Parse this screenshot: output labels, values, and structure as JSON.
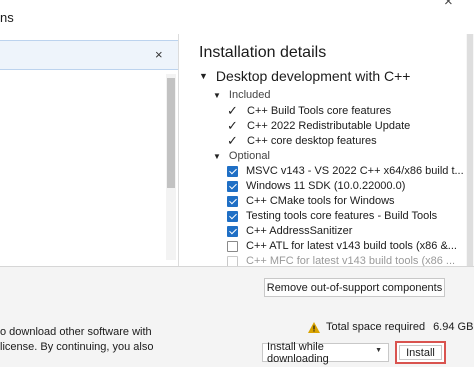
{
  "window": {
    "title": "ns",
    "close_icon": "close-icon"
  },
  "left_pane": {
    "search_value": "",
    "clear_icon": "×"
  },
  "details": {
    "title": "Installation details",
    "workload": "Desktop development with C++",
    "included_label": "Included",
    "included_items": [
      {
        "label": "C++ Build Tools core features"
      },
      {
        "label": "C++ 2022 Redistributable Update"
      },
      {
        "label": "C++ core desktop features"
      }
    ],
    "optional_label": "Optional",
    "optional_items": [
      {
        "label": "MSVC v143 - VS 2022 C++ x64/x86 build t...",
        "checked": true
      },
      {
        "label": "Windows 11 SDK (10.0.22000.0)",
        "checked": true
      },
      {
        "label": "C++ CMake tools for Windows",
        "checked": true
      },
      {
        "label": "Testing tools core features - Build Tools",
        "checked": true
      },
      {
        "label": "C++ AddressSanitizer",
        "checked": true
      },
      {
        "label": "C++ ATL for latest v143 build tools (x86 &...",
        "checked": false
      },
      {
        "label": "C++ MFC for latest v143 build tools (x86 ...",
        "checked": false
      }
    ]
  },
  "bottom": {
    "remove_label": "Remove out-of-support components",
    "license_line1": "o download other software with",
    "license_line2": "license. By continuing, you also",
    "space_label": "Total space required",
    "space_value": "6.94 GB",
    "install_mode": "Install while downloading",
    "install_label": "Install",
    "warn_color": "#d9a300",
    "install_border_color": "#d9534f",
    "checkbox_color": "#1f6fc5"
  }
}
